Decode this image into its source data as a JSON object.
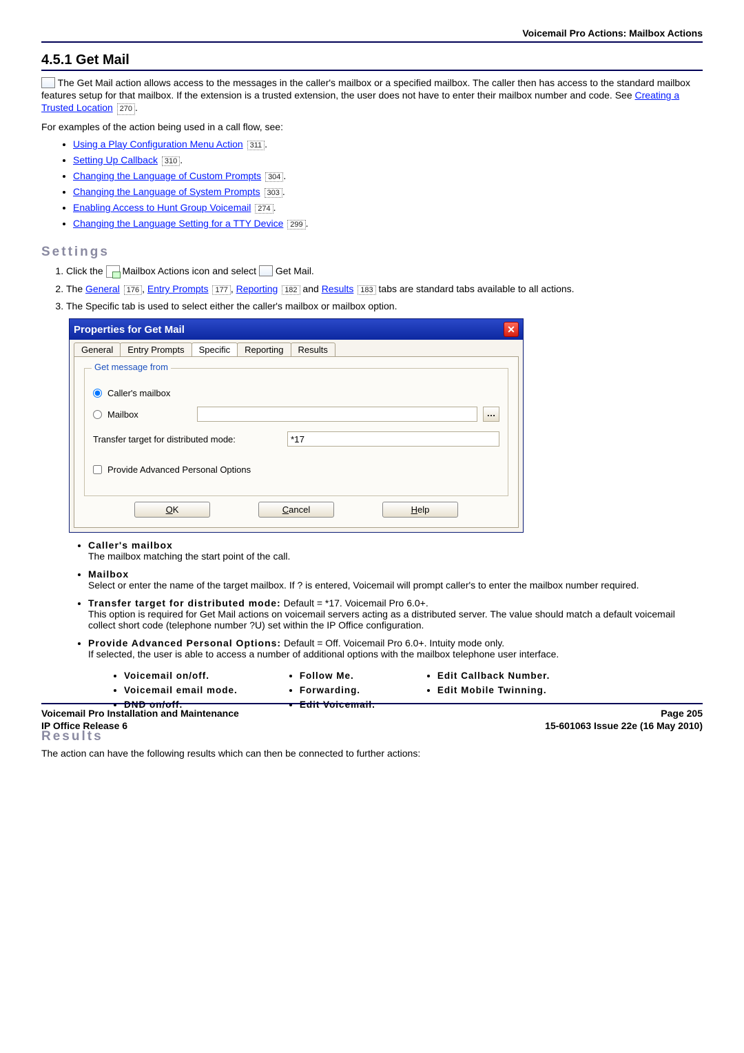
{
  "header": {
    "right": "Voicemail Pro Actions: Mailbox Actions"
  },
  "section": {
    "number": "4.5.1",
    "title": "Get Mail"
  },
  "intro": {
    "p1a": "The Get Mail action allows access to the messages in the caller's mailbox or a specified mailbox. The caller then has access to the standard mailbox features setup for that mailbox. If the extension is a trusted extension, the user does not have to enter their mailbox number and code. See ",
    "link_trusted": "Creating a Trusted Location",
    "ref_trusted": "270",
    "p1b": ".",
    "p2": "For examples of the action being used in a call flow, see:"
  },
  "examples": [
    {
      "text": "Using a Play Configuration Menu Action",
      "ref": "311"
    },
    {
      "text": "Setting Up Callback",
      "ref": "310"
    },
    {
      "text": "Changing the Language of Custom Prompts",
      "ref": "304"
    },
    {
      "text": "Changing the Language of System Prompts",
      "ref": "303"
    },
    {
      "text": "Enabling Access to Hunt Group Voicemail",
      "ref": "274"
    },
    {
      "text": "Changing the Language Setting for a TTY Device",
      "ref": "299"
    }
  ],
  "settings_heading": "Settings",
  "step1a": "Click the ",
  "step1b": " Mailbox Actions icon and select ",
  "step1c": " Get Mail.",
  "step2a": "The ",
  "link_general": "General",
  "ref_general": "176",
  "link_entry": "Entry Prompts",
  "ref_entry": "177",
  "link_reporting": "Reporting",
  "ref_reporting": "182",
  "link_results": "Results",
  "ref_results": "183",
  "step2b": " tabs are standard tabs available to all actions.",
  "step3": "The Specific tab is used to select either the caller's mailbox or mailbox option.",
  "dialog": {
    "title": "Properties for Get Mail",
    "tabs": [
      "General",
      "Entry Prompts",
      "Specific",
      "Reporting",
      "Results"
    ],
    "group_legend": "Get message from",
    "radio_callers": "Caller's mailbox",
    "radio_mailbox": "Mailbox",
    "transfer_label": "Transfer target for distributed mode:",
    "transfer_value": "*17",
    "check_apo": "Provide Advanced Personal Options",
    "btn_ok": "OK",
    "btn_cancel": "Cancel",
    "btn_help": "Help"
  },
  "defs": {
    "callers_label": "Caller's mailbox",
    "callers_text": "The mailbox matching the start point of the call.",
    "mailbox_label": "Mailbox",
    "mailbox_text": "Select or enter the name of the target mailbox. If ? is entered, Voicemail will prompt caller's to enter the mailbox number required.",
    "transfer_label": "Transfer target for distributed mode:",
    "transfer_meta": " Default = *17. Voicemail Pro 6.0+.",
    "transfer_text": "This option is required for Get Mail actions on voicemail servers acting as a distributed server. The value should match a default voicemail collect short code (telephone number ?U) set within the IP Office configuration.",
    "apo_label": "Provide Advanced Personal Options:",
    "apo_meta": " Default = Off. Voicemail Pro 6.0+. Intuity mode only.",
    "apo_text": "If selected, the user is able to access a number of additional options with the mailbox telephone user interface."
  },
  "apo_columns": [
    [
      "Voicemail on/off.",
      "Voicemail email mode.",
      "DND on/off."
    ],
    [
      "Follow Me.",
      "Forwarding.",
      "Edit Voicemail."
    ],
    [
      "Edit Callback Number.",
      "Edit Mobile Twinning."
    ]
  ],
  "results_heading": "Results",
  "results_text": "The action can have the following results which can then be connected to further actions:",
  "footer": {
    "left1": "Voicemail Pro Installation and Maintenance",
    "left2": "IP Office Release 6",
    "right1": "Page 205",
    "right2": "15-601063 Issue 22e (16 May 2010)"
  }
}
